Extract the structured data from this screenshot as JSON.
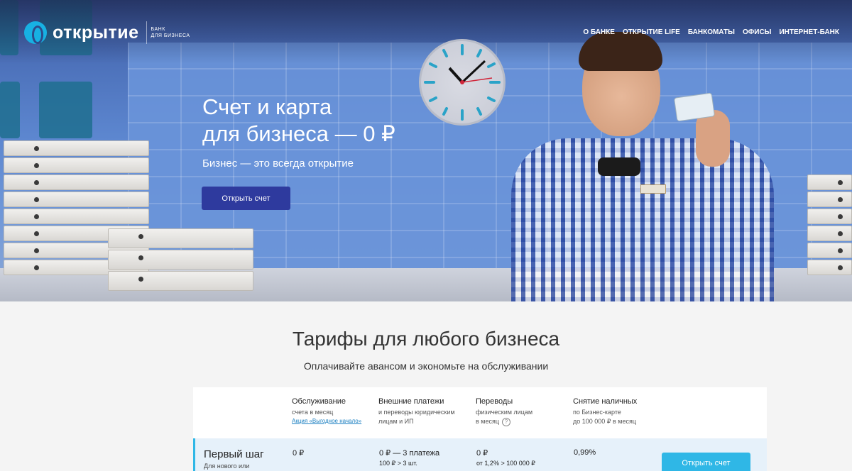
{
  "brand": {
    "name": "открытие",
    "sub_line1": "БАНК",
    "sub_line2": "ДЛЯ БИЗНЕСА"
  },
  "nav": [
    "О БАНКЕ",
    "ОТКРЫТИЕ LIFE",
    "БАНКОМАТЫ",
    "ОФИСЫ",
    "ИНТЕРНЕТ-БАНК"
  ],
  "hero": {
    "title": "Счет и карта\nдля бизнеса — 0 ₽",
    "subtitle": "Бизнес — это всегда открытие",
    "cta": "Открыть счет"
  },
  "tariffs": {
    "title": "Тарифы для любого бизнеса",
    "subtitle": "Оплачивайте авансом и экономьте на обслуживании",
    "columns": [
      {
        "title": "Обслуживание",
        "sub": "счета в месяц",
        "promo": "Акция «Выгодное начало»"
      },
      {
        "title": "Внешние платежи",
        "sub": "и переводы юридическим\nлицам и ИП"
      },
      {
        "title": "Переводы",
        "sub": "физическим лицам\nв месяц",
        "help": "?"
      },
      {
        "title": "Снятие наличных",
        "sub": "по Бизнес-карте\nдо 100 000 ₽ в месяц"
      }
    ],
    "rows": [
      {
        "plan": "Первый шаг",
        "plan_sub": "Для нового или",
        "service": "0 ₽",
        "payments": "0 ₽ — 3 платежа",
        "payments_sub": "100 ₽ > 3 шт.",
        "transfers": "0 ₽",
        "transfers_sub": "от 1,2% > 100 000 ₽",
        "cash": "0,99%",
        "button": "Открыть счет"
      }
    ]
  }
}
